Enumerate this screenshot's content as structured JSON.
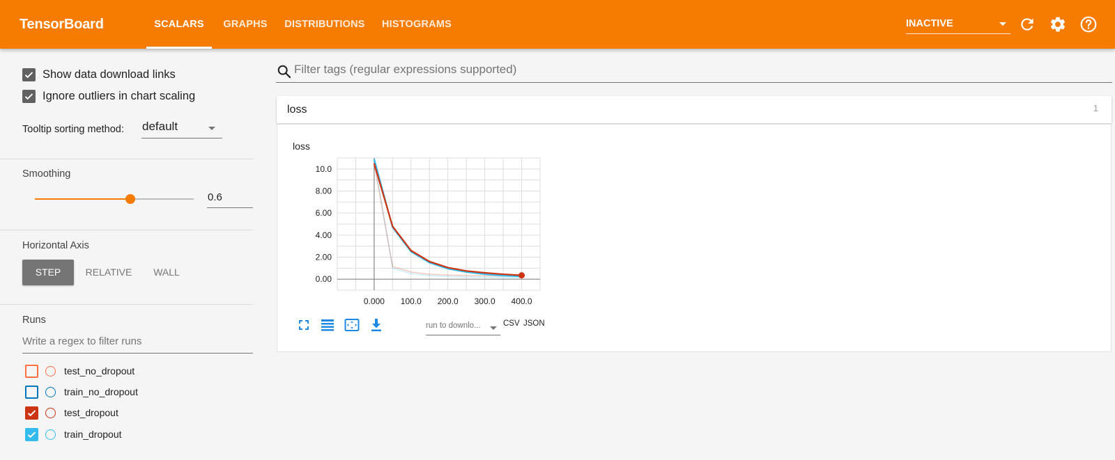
{
  "app": {
    "title": "TensorBoard",
    "accent": "#f57c00"
  },
  "tabs": [
    {
      "label": "SCALARS",
      "active": true
    },
    {
      "label": "GRAPHS",
      "active": false
    },
    {
      "label": "DISTRIBUTIONS",
      "active": false
    },
    {
      "label": "HISTOGRAMS",
      "active": false
    }
  ],
  "toolbar": {
    "status_value": "INACTIVE",
    "icons": [
      "reload-icon",
      "settings-icon",
      "help-icon"
    ]
  },
  "sidebar": {
    "show_download_links": {
      "label": "Show data download links",
      "checked": true
    },
    "ignore_outliers": {
      "label": "Ignore outliers in chart scaling",
      "checked": true
    },
    "tooltip_sorting": {
      "label": "Tooltip sorting method:",
      "value": "default"
    },
    "smoothing": {
      "title": "Smoothing",
      "value": "0.6",
      "level": 0.6
    },
    "horizontal_axis": {
      "title": "Horizontal Axis",
      "options": [
        {
          "label": "STEP",
          "active": true
        },
        {
          "label": "RELATIVE",
          "active": false
        },
        {
          "label": "WALL",
          "active": false
        }
      ]
    },
    "runs": {
      "title": "Runs",
      "filter_placeholder": "Write a regex to filter runs",
      "items": [
        {
          "name": "test_no_dropout",
          "color": "#ff7043",
          "checked": false
        },
        {
          "name": "train_no_dropout",
          "color": "#0077bb",
          "checked": false
        },
        {
          "name": "test_dropout",
          "color": "#cc3311",
          "checked": true
        },
        {
          "name": "train_dropout",
          "color": "#33bbee",
          "checked": true
        }
      ]
    }
  },
  "main": {
    "filter_placeholder": "Filter tags (regular expressions supported)",
    "category": {
      "title": "loss",
      "count": "1"
    },
    "card": {
      "title": "loss",
      "download_select": "run to downlo...",
      "csv_label": "CSV",
      "json_label": "JSON",
      "tool_icons": [
        "fullscreen-icon",
        "log-scale-icon",
        "fit-domain-icon",
        "download-icon"
      ]
    }
  },
  "chart_data": {
    "type": "line",
    "title": "loss",
    "xlabel": "",
    "ylabel": "",
    "xlim": [
      -100,
      450
    ],
    "ylim": [
      -1,
      11
    ],
    "x_ticks": [
      "0.000",
      "100.0",
      "200.0",
      "300.0",
      "400.0"
    ],
    "y_ticks": [
      "0.00",
      "2.00",
      "4.00",
      "6.00",
      "8.00",
      "10.0"
    ],
    "grid": true,
    "series": [
      {
        "name": "train_dropout",
        "color": "#33bbee",
        "x": [
          0,
          50,
          100,
          150,
          200,
          250,
          300,
          350,
          400
        ],
        "y": [
          10.9,
          4.7,
          2.5,
          1.5,
          0.95,
          0.65,
          0.45,
          0.32,
          0.25
        ],
        "raw_y": [
          10.9,
          1.0,
          0.5,
          0.32,
          0.25,
          0.2,
          0.17,
          0.15,
          0.13
        ]
      },
      {
        "name": "test_dropout",
        "color": "#cc3311",
        "x": [
          0,
          50,
          100,
          150,
          200,
          250,
          300,
          350,
          400
        ],
        "y": [
          10.5,
          4.8,
          2.6,
          1.6,
          1.05,
          0.75,
          0.58,
          0.45,
          0.35
        ],
        "raw_y": [
          10.5,
          1.15,
          0.65,
          0.45,
          0.38,
          0.33,
          0.3,
          0.28,
          0.27
        ]
      }
    ]
  }
}
